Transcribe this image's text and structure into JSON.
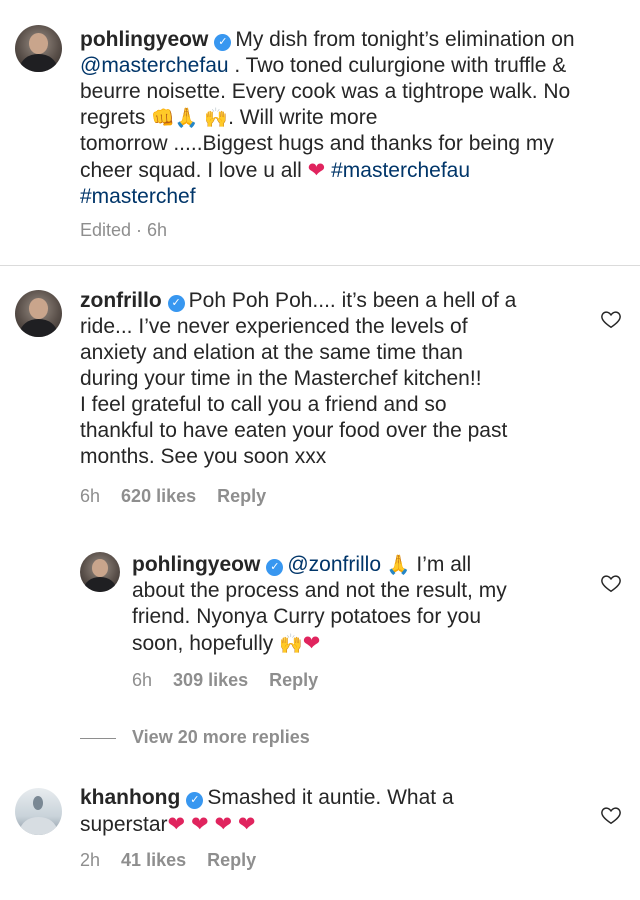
{
  "post": {
    "username": "pohlingyeow",
    "caption_lines": [
      "My dish from tonight’s elimination on",
      "@masterchefau",
      " . Two toned culurgione with truffle &",
      "beurre noisette. Every cook was a tightrope walk. No",
      "regrets",
      ". Will write more",
      "tomorrow .....Biggest hugs and thanks for being my",
      "cheer squad. I love u all",
      "#masterchefau",
      "#masterchef"
    ],
    "meta": "Edited · 6h"
  },
  "comments": [
    {
      "username": "zonfrillo",
      "lines": [
        "Poh Poh Poh.... it’s been a hell of a",
        "ride... I’ve never experienced the levels of",
        "anxiety and elation at the same time than",
        "during your time in the Masterchef kitchen!!",
        "I feel grateful to call you a friend and so",
        "thankful to have eaten your food over the past",
        "months. See you soon xxx"
      ],
      "time": "6h",
      "likes": "620 likes",
      "reply": "Reply"
    },
    {
      "username": "pohlingyeow",
      "mention": "@zonfrillo",
      "lines": [
        "I’m all",
        "about the process and not the result, my",
        "friend. Nyonya Curry potatoes for you",
        "soon, hopefully"
      ],
      "time": "6h",
      "likes": "309 likes",
      "reply": "Reply"
    },
    {
      "username": "khanhong",
      "lines": [
        "Smashed it auntie. What a",
        "superstar"
      ],
      "time": "2h",
      "likes": "41 likes",
      "reply": "Reply"
    }
  ],
  "view_more": "View 20 more replies",
  "icons": {
    "verified": "verified-badge-icon",
    "like": "heart-outline-icon",
    "fist": "fist-icon",
    "pray": "praying-hands-icon",
    "raised_hands": "raised-hands-icon",
    "red_heart": "red-heart-icon"
  },
  "colors": {
    "link": "#003569",
    "verified": "#3897f0",
    "meta": "#8e8e8e",
    "heart": "#e0245e"
  }
}
